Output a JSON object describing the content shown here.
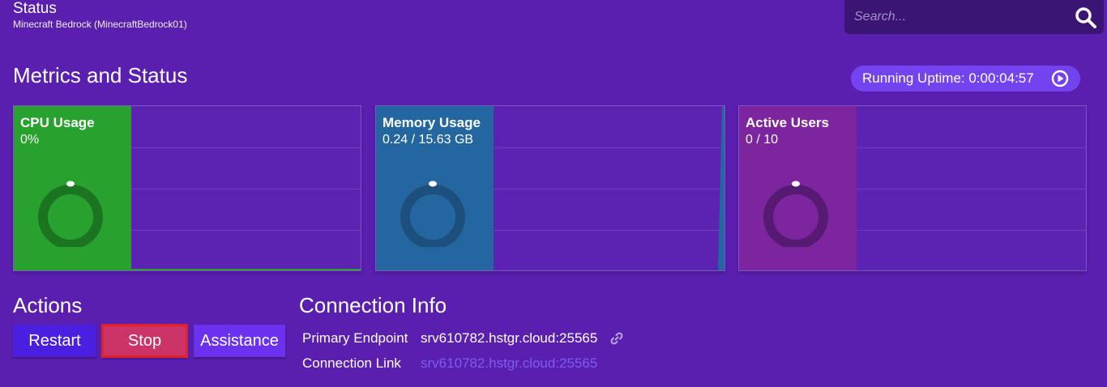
{
  "header": {
    "title": "Status",
    "subtitle": "Minecraft Bedrock (MinecraftBedrock01)"
  },
  "search": {
    "placeholder": "Search...",
    "value": "",
    "icon": "search-icon"
  },
  "metrics": {
    "title": "Metrics and Status",
    "uptime_label": "Running Uptime: 0:00:04:57",
    "uptime_icon": "play-circle-icon",
    "cards": [
      {
        "label": "CPU Usage",
        "value": "0%",
        "level": 0,
        "color": "#29a12f",
        "ring_color": "#1a7420"
      },
      {
        "label": "Memory Usage",
        "value": "0.24 / 15.63 GB",
        "level": 0.015,
        "color": "#2466a0",
        "ring_color": "#1d4f7c"
      },
      {
        "label": "Active Users",
        "value": "0 / 10",
        "level": 0,
        "color": "#7c259e",
        "ring_color": "#561a73"
      }
    ]
  },
  "actions": {
    "title": "Actions",
    "restart_label": "Restart",
    "stop_label": "Stop",
    "assistance_label": "Assistance"
  },
  "connection": {
    "title": "Connection Info",
    "primary_endpoint_label": "Primary Endpoint",
    "primary_endpoint_value": "srv610782.hstgr.cloud:25565",
    "connection_link_label": "Connection Link",
    "connection_link_value": "srv610782.hstgr.cloud:25565",
    "copy_icon": "link-icon"
  },
  "colors": {
    "background": "#5b1fb0",
    "accent": "#7443f0",
    "stop": "#cc3468",
    "link": "#7c5cf0"
  }
}
